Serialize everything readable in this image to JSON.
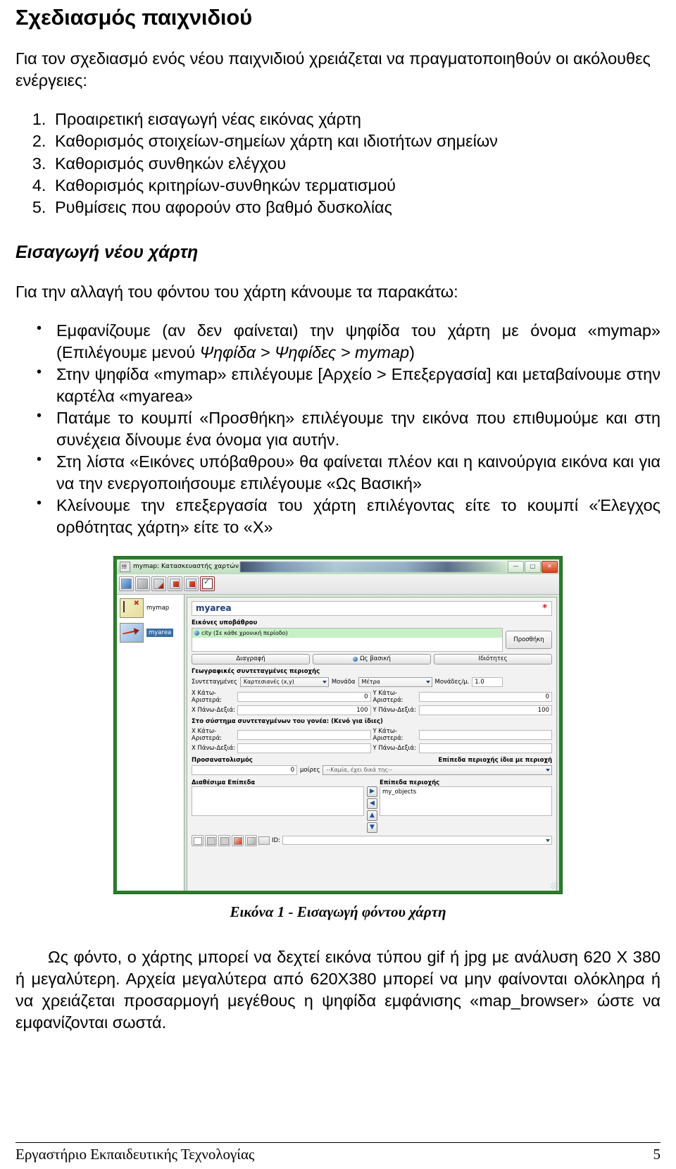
{
  "document": {
    "title": "Σχεδιασμός παιχνιδιού",
    "intro": "Για τον σχεδιασμό ενός νέου παιχνιδιού χρειάζεται να πραγματοποιηθούν οι ακόλουθες ενέργειες:",
    "steps": [
      "Προαιρετική εισαγωγή νέας εικόνας χάρτη",
      "Καθορισμός στοιχείων-σημείων χάρτη και ιδιοτήτων σημείων",
      "Καθορισμός συνθηκών ελέγχου",
      "Καθορισμός κριτηρίων-συνθηκών τερματισμού",
      "Ρυθμίσεις που αφορούν στο βαθμό δυσκολίας"
    ],
    "section_title": "Εισαγωγή νέου χάρτη",
    "lead": "Για την αλλαγή του φόντου του χάρτη κάνουμε τα παρακάτω:",
    "bullets": [
      {
        "part1": "Εμφανίζουμε (αν δεν φαίνεται) την ψηφίδα του χάρτη με όνομα «mymap» (Επιλέγουμε μενού ",
        "italic": "Ψηφίδα > Ψηφίδες > mymap",
        "part2": ")"
      },
      {
        "part1": "Στην ψηφίδα «mymap» επιλέγουμε [Αρχείο > Επεξεργασία] και μεταβαίνουμε στην καρτέλα «myarea»",
        "italic": "",
        "part2": ""
      },
      {
        "part1": "Πατάμε το κουμπί «Προσθήκη» επιλέγουμε την εικόνα που επιθυμούμε και στη συνέχεια δίνουμε ένα όνομα για αυτήν.",
        "italic": "",
        "part2": ""
      },
      {
        "part1": "Στη λίστα «Εικόνες υπόβαθρου» θα φαίνεται πλέον και η καινούργια εικόνα και για να την ενεργοποιήσουμε επιλέγουμε «Ως Βασική»",
        "italic": "",
        "part2": ""
      },
      {
        "part1": "Κλείνουμε την επεξεργασία του χάρτη επιλέγοντας είτε το κουμπί «Έλεγχος ορθότητας χάρτη» είτε το «Χ»",
        "italic": "",
        "part2": ""
      }
    ],
    "figure_caption": "Εικόνα 1 - Εισαγωγή φόντου χάρτη",
    "closing": "Ως φόντο, ο χάρτης μπορεί να δεχτεί εικόνα τύπου gif ή jpg με ανάλυση 620 Χ 380 ή μεγαλύτερη. Αρχεία μεγαλύτερα από 620Χ380 μπορεί να μην φαίνονται ολόκληρα ή να χρειάζεται προσαρμογή μεγέθους η ψηφίδα εμφάνισης «map_browser» ώστε να εμφανίζονται σωστά.",
    "footer_left": "Εργαστήριο Εκπαιδευτικής Τεχνολογίας",
    "footer_page": "5"
  },
  "app": {
    "window_title": "mymap: Κατασκευαστής χαρτών",
    "window_buttons": {
      "minimize": "—",
      "maximize": "□",
      "close": "✕"
    },
    "tree": [
      {
        "label": "mymap",
        "selected": false
      },
      {
        "label": "myarea",
        "selected": true
      }
    ],
    "name_field_value": "myarea",
    "required_marker": "*",
    "background_images": {
      "group_label": "Εικόνες υποβάθρου",
      "items": [
        "city (Σε κάθε χρονική περίοδο)"
      ],
      "add_button": "Προσθήκη",
      "delete_button": "Διαγραφή",
      "set_basic_button": "Ως βασική",
      "properties_button": "Ιδιότητες"
    },
    "geo": {
      "group_label": "Γεωγραφικές συντεταγμένες περιοχής",
      "coords_label": "Συντεταγμένες",
      "coords_value": "Καρτεσιανές (x,y)",
      "unit_label": "Μονάδα",
      "unit_value": "Μέτρα",
      "units_per_m_label": "Μονάδες/μ.",
      "units_per_m_value": "1.0",
      "x_bottom_left_label": "Χ Κάτω-Αριστερά:",
      "x_bottom_left_value": "0",
      "y_bottom_left_label": "Υ Κάτω-Αριστερά:",
      "y_bottom_left_value": "0",
      "x_top_right_label": "Χ Πάνω-Δεξιά:",
      "x_top_right_value": "100",
      "y_top_right_label": "Υ Πάνω-Δεξιά:",
      "y_top_right_value": "100"
    },
    "parent": {
      "group_label": "Στο σύστημα συντεταγμένων του γονέα: (Κενό για ίδιες)",
      "x_bottom_left_label": "Χ Κάτω-Αριστερά:",
      "x_bottom_left_value": "",
      "y_bottom_left_label": "Υ Κάτω-Αριστερά:",
      "y_bottom_left_value": "",
      "x_top_right_label": "Χ Πάνω-Δεξιά:",
      "x_top_right_value": "",
      "y_top_right_label": "Υ Πάνω-Δεξιά:",
      "y_top_right_value": ""
    },
    "orientation": {
      "label": "Προσανατολισμός",
      "value": "0",
      "unit": "μοίρες",
      "same_layers_label": "Επίπεδα περιοχής ίδια με περιοχή",
      "same_layers_value": "--Καμία, έχει δικά της--"
    },
    "layers": {
      "available_label": "Διαθέσιμα Επίπεδα",
      "available_items": [],
      "area_label": "Επίπεδα περιοχής",
      "area_items": [
        "my_objects"
      ],
      "arrows": [
        "▶",
        "◀",
        "▲",
        "▼"
      ]
    },
    "id_label": "ID:",
    "id_value": ""
  }
}
